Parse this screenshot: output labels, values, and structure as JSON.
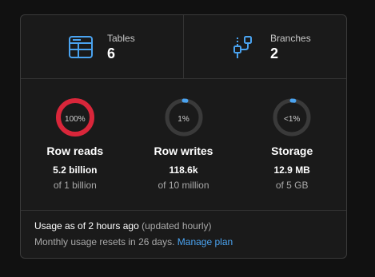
{
  "colors": {
    "accent": "#4aa3f0",
    "danger": "#d9263a",
    "ring_track": "#3a3a3a"
  },
  "stats": [
    {
      "icon": "table-icon",
      "label": "Tables",
      "value": "6"
    },
    {
      "icon": "branches-icon",
      "label": "Branches",
      "value": "2"
    }
  ],
  "usage": [
    {
      "name": "Row reads",
      "percent_label": "100%",
      "fraction": 1.0,
      "amount": "5.2 billion",
      "limit": "of 1 billion",
      "status": "over"
    },
    {
      "name": "Row writes",
      "percent_label": "1%",
      "fraction": 0.01,
      "amount": "118.6k",
      "limit": "of 10 million",
      "status": "ok"
    },
    {
      "name": "Storage",
      "percent_label": "<1%",
      "fraction": 0.005,
      "amount": "12.9 MB",
      "limit": "of 5 GB",
      "status": "ok"
    }
  ],
  "footer": {
    "usage_as_of": "Usage as of 2 hours ago",
    "update_note": "(updated hourly)",
    "reset_text": "Monthly usage resets in 26 days.",
    "manage_link": "Manage plan"
  }
}
